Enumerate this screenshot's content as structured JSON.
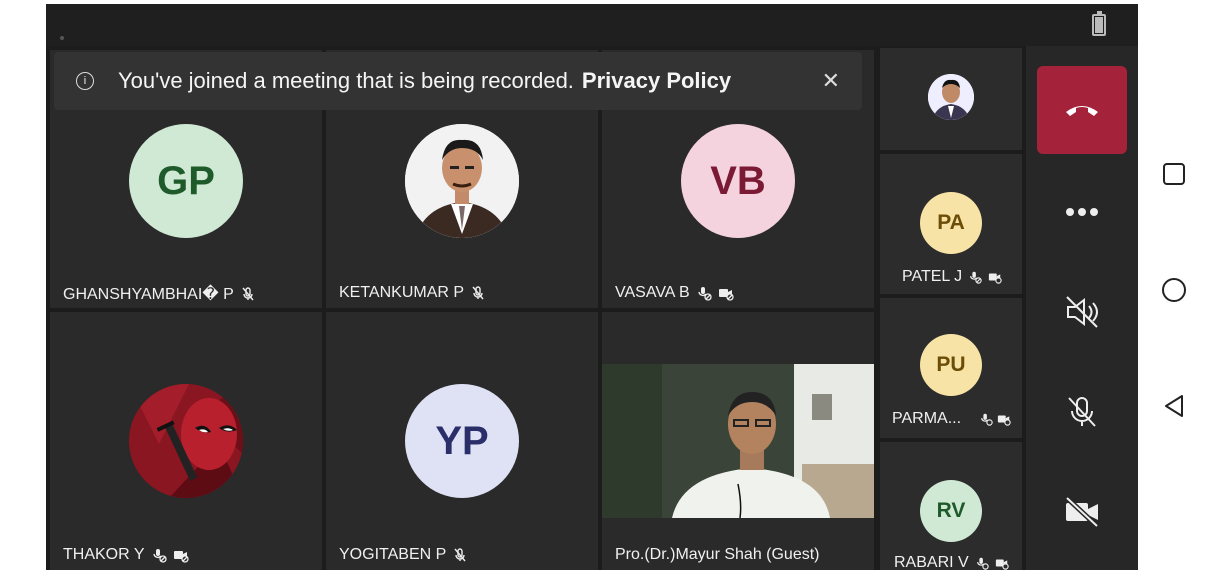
{
  "banner": {
    "message": "You've joined a meeting that is being recorded.",
    "link": "Privacy Policy"
  },
  "tiles": [
    {
      "initials": "GP",
      "name": "GHANSHYAMBHAI� P",
      "mic": "muted",
      "bg": "#cfe9d4",
      "fg": "#1f5a2b"
    },
    {
      "initials": "",
      "name": "KETANKUMAR P",
      "mic": "muted",
      "photo": "portrait-man-tie"
    },
    {
      "initials": "VB",
      "name": "VASAVA B",
      "mic": "muted-video-off",
      "bg": "#f5d3de",
      "fg": "#7a1a35"
    },
    {
      "initials": "",
      "name": "THAKOR Y",
      "mic": "muted-video-off",
      "photo": "deadpool-avatar"
    },
    {
      "initials": "YP",
      "name": "YOGITABEN P",
      "mic": "muted",
      "bg": "#dfe1f5",
      "fg": "#2a2f6a"
    },
    {
      "initials": "",
      "name": "Pro.(Dr.)Mayur Shah (Guest)",
      "mic": "",
      "photo": "live-video"
    }
  ],
  "side": [
    {
      "initials": "",
      "name": "",
      "photo": "small-portrait"
    },
    {
      "initials": "PA",
      "name": "PATEL J",
      "bg": "#f7e3a6",
      "fg": "#6b4d07"
    },
    {
      "initials": "PU",
      "name": "PARMA...",
      "bg": "#f7e3a6",
      "fg": "#6b4d07"
    },
    {
      "initials": "RV",
      "name": "RABARI V",
      "bg": "#cfe9d4",
      "fg": "#1f5a2b"
    }
  ],
  "colors": {
    "hangup": "#a4223a",
    "tile": "#2a2a2a",
    "screen": "#1c1c1c"
  }
}
